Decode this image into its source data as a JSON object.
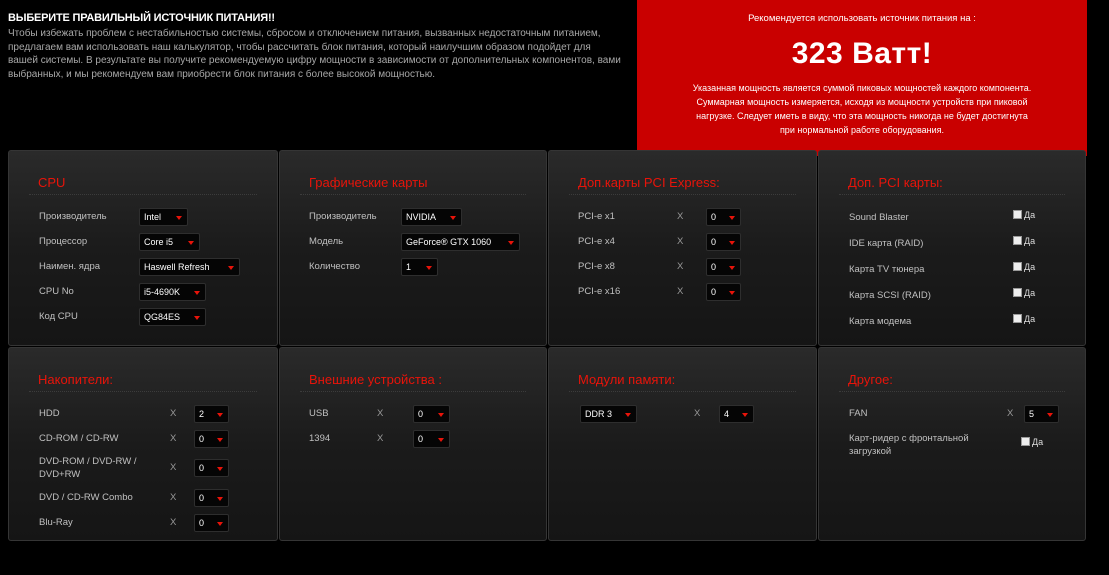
{
  "intro": {
    "title": "ВЫБЕРИТЕ ПРАВИЛЬНЫЙ ИСТОЧНИК ПИТАНИЯ!!",
    "text": "Чтобы избежать проблем с нестабильностью системы, сбросом и отключением питания, вызванных недостаточным питанием, предлагаем вам использовать наш калькулятор, чтобы рассчитать блок питания, который наилучшим образом подойдет для вашей системы. В результате вы получите рекомендуемую цифру мощности в зависимости от дополнительных компонентов, вами выбранных, и мы рекомендуем вам приобрести блок питания с более высокой мощностью."
  },
  "recommendation": {
    "heading": "Рекомендуется использовать источник питания на :",
    "value": "323 Ватт!",
    "note": "Указанная мощность является суммой пиковых мощностей каждого компонента. Суммарная мощность измеряется, исходя из мощности устройств при пиковой нагрузке. Следует иметь в виду, что эта мощность никогда не будет достигнута при нормальной работе оборудования."
  },
  "mult_sign": "X",
  "yes_label": "Да",
  "cpu": {
    "title": "CPU",
    "rows": [
      {
        "label": "Производитель",
        "value": "Intel"
      },
      {
        "label": "Процессор",
        "value": "Core i5"
      },
      {
        "label": "Наимен. ядра",
        "value": "Haswell Refresh"
      },
      {
        "label": "CPU No",
        "value": "i5-4690K"
      },
      {
        "label": "Код CPU",
        "value": "QG84ES"
      }
    ]
  },
  "gpu": {
    "title": "Графические карты",
    "rows": [
      {
        "label": "Производитель",
        "value": "NVIDIA"
      },
      {
        "label": "Модель",
        "value": "GeForce® GTX 1060"
      },
      {
        "label": "Количество",
        "value": "1"
      }
    ]
  },
  "pcie": {
    "title": "Доп.карты PCI Express:",
    "rows": [
      {
        "label": "PCI-e x1",
        "value": "0"
      },
      {
        "label": "PCI-e x4",
        "value": "0"
      },
      {
        "label": "PCI-e x8",
        "value": "0"
      },
      {
        "label": "PCI-e x16",
        "value": "0"
      }
    ]
  },
  "pci": {
    "title": "Доп. PCI карты:",
    "rows": [
      {
        "label": "Sound Blaster",
        "checked": false
      },
      {
        "label": "IDE карта (RAID)",
        "checked": false
      },
      {
        "label": "Карта TV тюнера",
        "checked": false
      },
      {
        "label": "Карта SCSI (RAID)",
        "checked": false
      },
      {
        "label": "Карта модема",
        "checked": false
      }
    ]
  },
  "storage": {
    "title": "Накопители:",
    "rows": [
      {
        "label": "HDD",
        "value": "2"
      },
      {
        "label": "CD-ROM / CD-RW",
        "value": "0"
      },
      {
        "label": "DVD-ROM / DVD-RW / DVD+RW",
        "value": "0"
      },
      {
        "label": "DVD / CD-RW Combo",
        "value": "0"
      },
      {
        "label": "Blu-Ray",
        "value": "0"
      }
    ]
  },
  "external": {
    "title": "Внешние устройства :",
    "rows": [
      {
        "label": "USB",
        "value": "0"
      },
      {
        "label": "1394",
        "value": "0"
      }
    ]
  },
  "memory": {
    "title": "Модули памяти:",
    "type_value": "DDR 3",
    "count_value": "4"
  },
  "other": {
    "title": "Другое:",
    "fan_label": "FAN",
    "fan_value": "5",
    "cardreader_label": "Карт-ридер с фронтальной загрузкой",
    "cardreader_checked": false
  }
}
